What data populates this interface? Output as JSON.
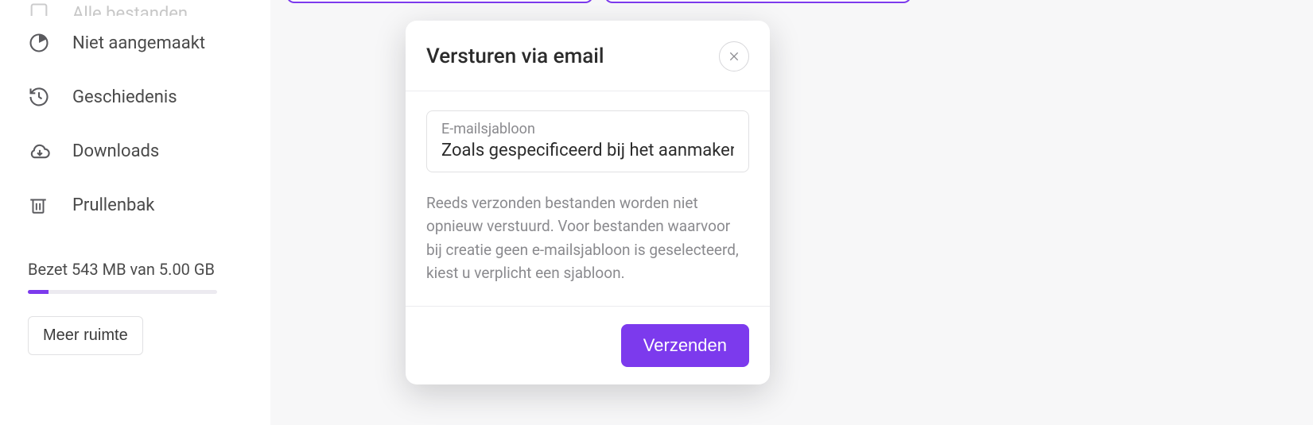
{
  "sidebar": {
    "items": [
      {
        "label": "Alle bestanden",
        "icon": "files-icon"
      },
      {
        "label": "Niet aangemaakt",
        "icon": "pie-icon"
      },
      {
        "label": "Geschiedenis",
        "icon": "history-icon"
      },
      {
        "label": "Downloads",
        "icon": "cloud-download-icon"
      },
      {
        "label": "Prullenbak",
        "icon": "trash-icon"
      }
    ]
  },
  "storage": {
    "text": "Bezet 543 MB van 5.00 GB",
    "more_button": "Meer ruimte",
    "percent": 11
  },
  "modal": {
    "title": "Versturen via email",
    "select_label": "E-mailsjabloon",
    "select_value": "Zoals gespecificeerd bij het aanmaken",
    "info_text": "Reeds verzonden bestanden worden niet opnieuw verstuurd. Voor bestanden waarvoor bij creatie geen e-mailsjabloon is geselecteerd, kiest u verplicht een sjabloon.",
    "send_button": "Verzenden"
  },
  "colors": {
    "accent": "#7c3aed"
  }
}
